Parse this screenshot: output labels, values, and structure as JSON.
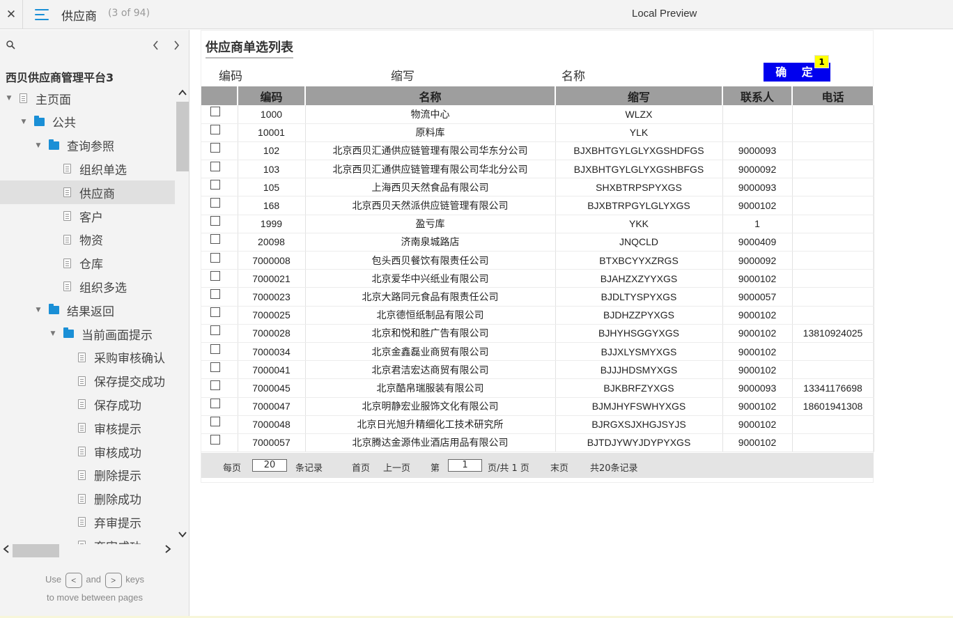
{
  "topbar": {
    "close_glyph": "✕",
    "page_name": "供应商",
    "page_count": "(3 of 94)",
    "preview_title": "Local Preview"
  },
  "sidebar": {
    "project_title": "西贝供应商管理平台3",
    "tree": [
      {
        "label": "主页面",
        "level": 0,
        "type": "page",
        "expanded": true
      },
      {
        "label": "公共",
        "level": 1,
        "type": "folder",
        "expanded": true
      },
      {
        "label": "查询参照",
        "level": 2,
        "type": "folder",
        "expanded": true
      },
      {
        "label": "组织单选",
        "level": 3,
        "type": "page"
      },
      {
        "label": "供应商",
        "level": 3,
        "type": "page",
        "selected": true
      },
      {
        "label": "客户",
        "level": 3,
        "type": "page"
      },
      {
        "label": "物资",
        "level": 3,
        "type": "page"
      },
      {
        "label": "仓库",
        "level": 3,
        "type": "page"
      },
      {
        "label": "组织多选",
        "level": 3,
        "type": "page"
      },
      {
        "label": "结果返回",
        "level": 2,
        "type": "folder",
        "expanded": true
      },
      {
        "label": "当前画面提示",
        "level": 3,
        "type": "folder",
        "expanded": true
      },
      {
        "label": "采购审核确认",
        "level": 4,
        "type": "page"
      },
      {
        "label": "保存提交成功",
        "level": 4,
        "type": "page"
      },
      {
        "label": "保存成功",
        "level": 4,
        "type": "page"
      },
      {
        "label": "审核提示",
        "level": 4,
        "type": "page"
      },
      {
        "label": "审核成功",
        "level": 4,
        "type": "page"
      },
      {
        "label": "删除提示",
        "level": 4,
        "type": "page"
      },
      {
        "label": "删除成功",
        "level": 4,
        "type": "page"
      },
      {
        "label": "弃审提示",
        "level": 4,
        "type": "page"
      },
      {
        "label": "弃审成功",
        "level": 4,
        "type": "page"
      }
    ],
    "help": {
      "use": "Use",
      "key_prev": "<",
      "and": "and",
      "key_next": ">",
      "keys": "keys",
      "line2": "to move between pages"
    }
  },
  "main": {
    "form_title": "供应商单选列表",
    "filters": {
      "code": "编码",
      "abbr": "缩写",
      "name": "名称"
    },
    "confirm_label": "确 定",
    "confirm_badge": "1",
    "columns": [
      "",
      "编码",
      "名称",
      "缩写",
      "联系人",
      "电话"
    ],
    "rows": [
      {
        "code": "1000",
        "name": "物流中心",
        "abbr": "WLZX",
        "contact": "",
        "phone": ""
      },
      {
        "code": "10001",
        "name": "原料库",
        "abbr": "YLK",
        "contact": "",
        "phone": ""
      },
      {
        "code": "102",
        "name": "北京西贝汇通供应链管理有限公司华东分公司",
        "abbr": "BJXBHTGYLGLYXGSHDFGS",
        "contact": "9000093",
        "phone": ""
      },
      {
        "code": "103",
        "name": "北京西贝汇通供应链管理有限公司华北分公司",
        "abbr": "BJXBHTGYLGLYXGSHBFGS",
        "contact": "9000092",
        "phone": ""
      },
      {
        "code": "105",
        "name": "上海西贝天然食品有限公司",
        "abbr": "SHXBTRPSPYXGS",
        "contact": "9000093",
        "phone": ""
      },
      {
        "code": "168",
        "name": "北京西贝天然派供应链管理有限公司",
        "abbr": "BJXBTRPGYLGLYXGS",
        "contact": "9000102",
        "phone": ""
      },
      {
        "code": "1999",
        "name": "盈亏库",
        "abbr": "YKK",
        "contact": "1",
        "phone": ""
      },
      {
        "code": "20098",
        "name": "济南泉城路店",
        "abbr": "JNQCLD",
        "contact": "9000409",
        "phone": ""
      },
      {
        "code": "7000008",
        "name": "包头西贝餐饮有限责任公司",
        "abbr": "BTXBCYYXZRGS",
        "contact": "9000092",
        "phone": ""
      },
      {
        "code": "7000021",
        "name": "北京爱华中兴纸业有限公司",
        "abbr": "BJAHZXZYYXGS",
        "contact": "9000102",
        "phone": ""
      },
      {
        "code": "7000023",
        "name": "北京大路同元食品有限责任公司",
        "abbr": "BJDLTYSPYXGS",
        "contact": "9000057",
        "phone": ""
      },
      {
        "code": "7000025",
        "name": "北京德恒纸制品有限公司",
        "abbr": "BJDHZZPYXGS",
        "contact": "9000102",
        "phone": ""
      },
      {
        "code": "7000028",
        "name": "北京和悦和胜广告有限公司",
        "abbr": "BJHYHSGGYXGS",
        "contact": "9000102",
        "phone": "13810924025"
      },
      {
        "code": "7000034",
        "name": "北京金鑫磊业商贸有限公司",
        "abbr": "BJJXLYSMYXGS",
        "contact": "9000102",
        "phone": ""
      },
      {
        "code": "7000041",
        "name": "北京君洁宏达商贸有限公司",
        "abbr": "BJJJHDSMYXGS",
        "contact": "9000102",
        "phone": ""
      },
      {
        "code": "7000045",
        "name": "北京酷帛瑞服装有限公司",
        "abbr": "BJKBRFZYXGS",
        "contact": "9000093",
        "phone": "13341176698"
      },
      {
        "code": "7000047",
        "name": "北京明静宏业服饰文化有限公司",
        "abbr": "BJMJHYFSWHYXGS",
        "contact": "9000102",
        "phone": "18601941308"
      },
      {
        "code": "7000048",
        "name": "北京日光旭升精细化工技术研究所",
        "abbr": "BJRGXSJXHGJSYJS",
        "contact": "9000102",
        "phone": ""
      },
      {
        "code": "7000057",
        "name": "北京腾达金源伟业酒店用品有限公司",
        "abbr": "BJTDJYWYJDYPYXGS",
        "contact": "9000102",
        "phone": ""
      }
    ],
    "pager": {
      "per_page_label": "每页",
      "per_page_value": "20",
      "records_label": "条记录",
      "first": "首页",
      "prev": "上一页",
      "page_label": "第",
      "page_value": "1",
      "page_of": "页/共 1 页",
      "last": "末页",
      "total": "共20条记录"
    }
  }
}
